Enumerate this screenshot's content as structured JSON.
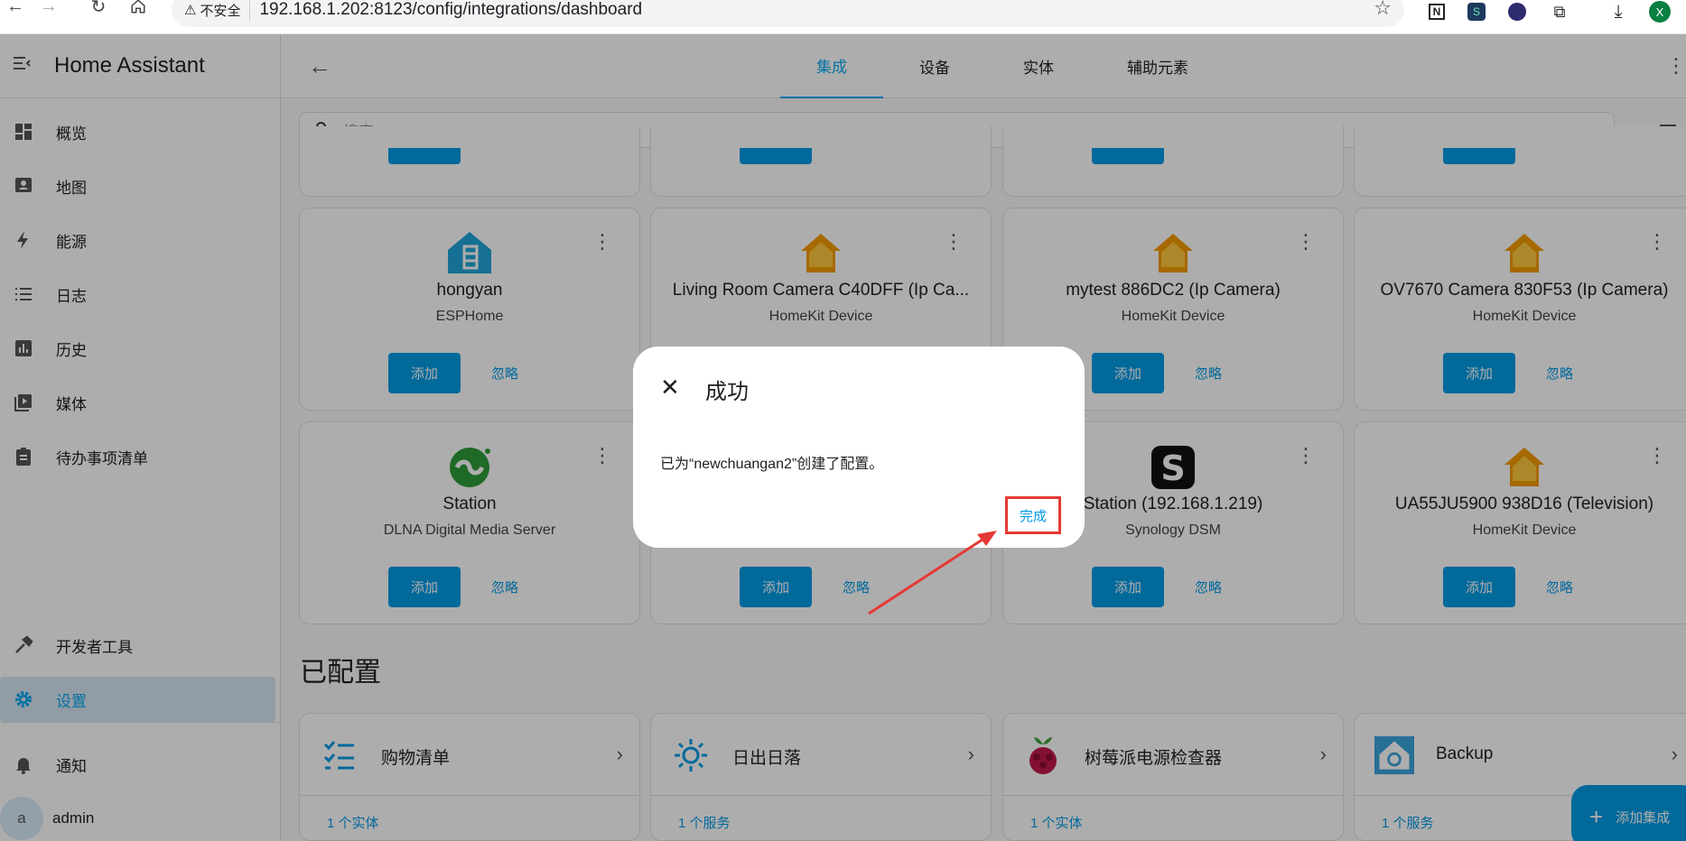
{
  "browser": {
    "insecure_label": "不安全",
    "url": "192.168.1.202:8123/config/integrations/dashboard",
    "profile_initial": "X"
  },
  "sidebar": {
    "title": "Home Assistant",
    "items": [
      {
        "label": "概览",
        "icon": "dashboard-icon"
      },
      {
        "label": "地图",
        "icon": "map-icon"
      },
      {
        "label": "能源",
        "icon": "lightning-icon"
      },
      {
        "label": "日志",
        "icon": "list-icon"
      },
      {
        "label": "历史",
        "icon": "chart-icon"
      },
      {
        "label": "媒体",
        "icon": "media-icon"
      },
      {
        "label": "待办事项清单",
        "icon": "clipboard-icon"
      }
    ],
    "developer_tools": "开发者工具",
    "settings": "设置",
    "notifications": "通知",
    "user": "admin",
    "user_initial": "a"
  },
  "tabs": [
    "集成",
    "设备",
    "实体",
    "辅助元素"
  ],
  "search": {
    "placeholder": "搜索"
  },
  "discovered": [
    {
      "name": "hongyan",
      "sub": "ESPHome",
      "icon": "esphome-icon"
    },
    {
      "name": "Living Room Camera C40DFF (Ip Ca...",
      "sub": "HomeKit Device",
      "icon": "homekit-icon"
    },
    {
      "name": "mytest 886DC2 (Ip Camera)",
      "sub": "HomeKit Device",
      "icon": "homekit-icon"
    },
    {
      "name": "OV7670 Camera 830F53 (Ip Camera)",
      "sub": "HomeKit Device",
      "icon": "homekit-icon"
    },
    {
      "name": "Station",
      "sub": "DLNA Digital Media Server",
      "icon": "dlna-icon"
    },
    {
      "name": "",
      "sub": "",
      "icon": ""
    },
    {
      "name": "Station (192.168.1.219)",
      "sub": "Synology DSM",
      "icon": "synology-icon"
    },
    {
      "name": "UA55JU5900 938D16 (Television)",
      "sub": "HomeKit Device",
      "icon": "homekit-icon"
    }
  ],
  "buttons": {
    "add": "添加",
    "ignore": "忽略"
  },
  "configured_title": "已配置",
  "configured": [
    {
      "name": "购物清单",
      "foot": "1 个实体",
      "icon": "shopping-list-icon"
    },
    {
      "name": "日出日落",
      "foot": "1 个服务",
      "icon": "sun-icon"
    },
    {
      "name": "树莓派电源检查器",
      "foot": "1 个实体",
      "icon": "raspberry-pi-icon"
    },
    {
      "name": "Backup",
      "foot": "1 个服务",
      "icon": "backup-icon"
    }
  ],
  "fab_label": "添加集成",
  "dialog": {
    "title": "成功",
    "body": "已为“newchuangan2”创建了配置。",
    "done": "完成"
  }
}
